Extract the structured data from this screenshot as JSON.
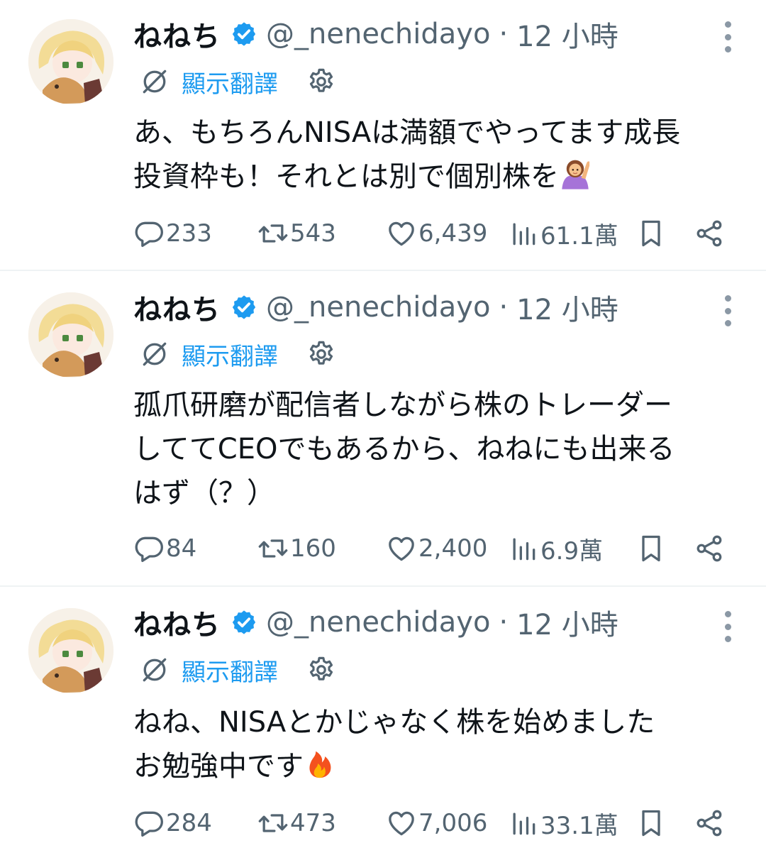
{
  "tweets": [
    {
      "author": "ねねち",
      "handle": "@_nenechidayo",
      "time": "12 小時",
      "translate_label": "顯示翻譯",
      "text": "あ、もちろんNISAは満額でやってます成長\n投資枠も！それとは別で個別株を",
      "emoji": "person-raising-hand-emoji",
      "replies": "233",
      "retweets": "543",
      "likes": "6,439",
      "views": "61.1萬"
    },
    {
      "author": "ねねち",
      "handle": "@_nenechidayo",
      "time": "12 小時",
      "translate_label": "顯示翻譯",
      "text": "孤爪研磨が配信者しながら株のトレーダー\nしててCEOでもあるから、ねねにも出来る\nはず（？）",
      "replies": "84",
      "retweets": "160",
      "likes": "2,400",
      "views": "6.9萬"
    },
    {
      "author": "ねねち",
      "handle": "@_nenechidayo",
      "time": "12 小時",
      "translate_label": "顯示翻譯",
      "text": "ねね、NISAとかじゃなく株を始めました\nお勉強中です",
      "emoji": "fire-emoji",
      "replies": "284",
      "retweets": "473",
      "likes": "7,006",
      "views": "33.1萬"
    }
  ],
  "colors": {
    "accent": "#1d9bf0",
    "muted": "#536471",
    "text": "#0f1419",
    "divider": "#eff3f4"
  }
}
